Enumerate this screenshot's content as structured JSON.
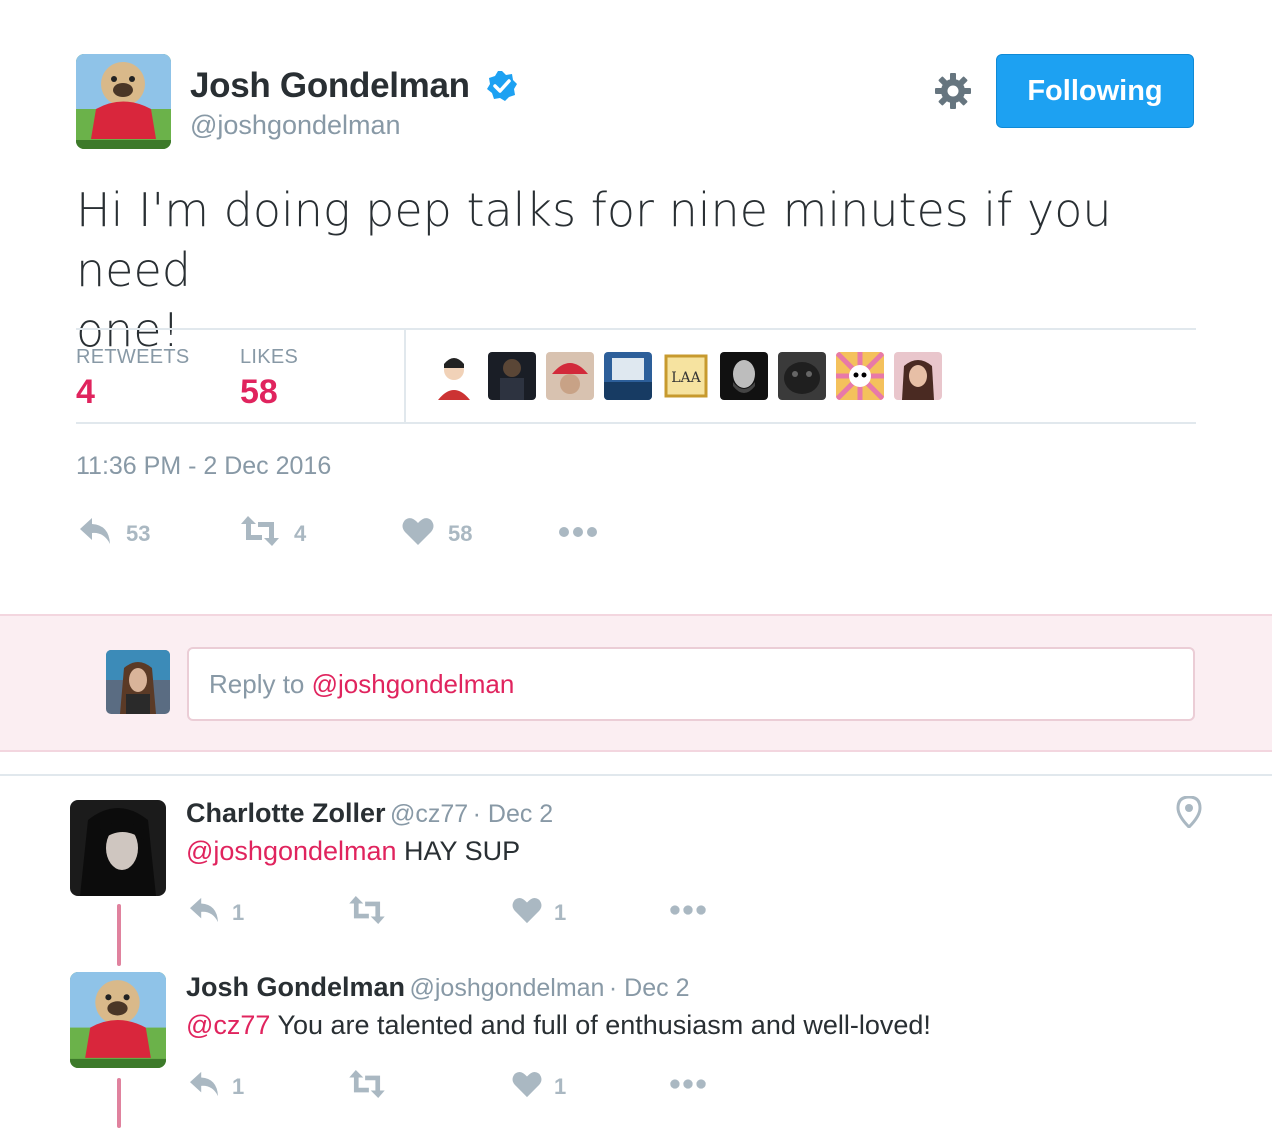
{
  "tweet": {
    "author_name": "Josh Gondelman",
    "handle": "@joshgondelman",
    "follow_label": "Following",
    "text_line1": "Hi I'm doing pep talks for nine minutes if you need",
    "text_line2": "one!",
    "retweets_label": "RETWEETS",
    "retweets_value": "4",
    "likes_label": "LIKES",
    "likes_value": "58",
    "timestamp": "11:36 PM - 2 Dec 2016",
    "actions": {
      "reply_count": "53",
      "retweet_count": "4",
      "like_count": "58"
    }
  },
  "reply_box": {
    "prefix": "Reply to ",
    "mention": "@joshgondelman"
  },
  "replies": [
    {
      "name": "Charlotte Zoller",
      "handle": "@cz77",
      "date": "· Dec 2",
      "mention": "@joshgondelman",
      "text": " HAY SUP",
      "reply_count": "1",
      "like_count": "1"
    },
    {
      "name": "Josh Gondelman",
      "handle": "@joshgondelman",
      "date": "· Dec 2",
      "mention": "@cz77",
      "text": " You are talented and full of enthusiasm and well-loved!",
      "reply_count": "1",
      "like_count": "1"
    }
  ],
  "colors": {
    "accent": "#e0245e",
    "follow_blue": "#1da1f2",
    "muted": "#8899a6",
    "icon_gray": "#aab8c2"
  }
}
